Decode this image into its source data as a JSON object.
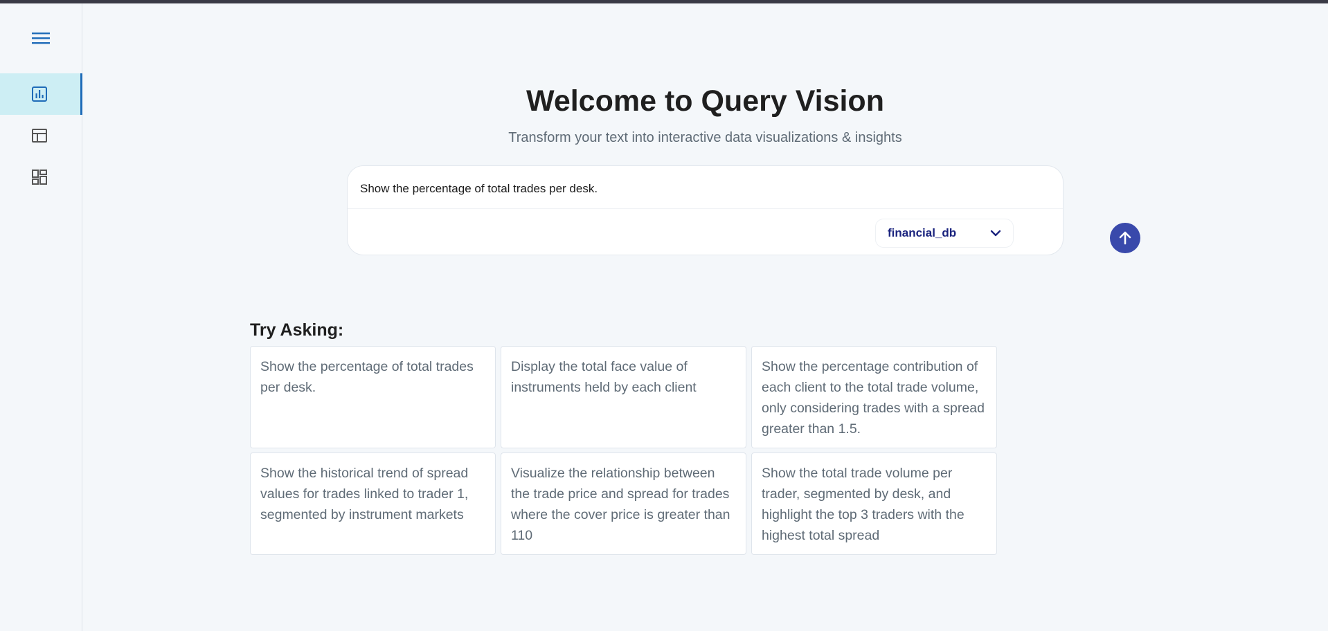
{
  "app": {
    "title": "Welcome to Query Vision",
    "subtitle": "Transform your text into interactive data visualizations & insights"
  },
  "sidebar": {
    "items": [
      {
        "icon": "bar-chart-icon",
        "active": true
      },
      {
        "icon": "table-icon",
        "active": false
      },
      {
        "icon": "dashboard-icon",
        "active": false
      }
    ]
  },
  "query": {
    "value": "Show the percentage of total trades per desk.",
    "database": "financial_db"
  },
  "suggestions": {
    "heading": "Try Asking:",
    "items": [
      "Show the percentage of total trades per desk.",
      "Display the total face value of instruments held by each client",
      "Show the percentage contribution of each client to the total trade volume, only considering trades with a spread greater than 1.5.",
      "Show the historical trend of spread values for trades linked to trader 1, segmented by instrument markets",
      "Visualize the relationship between the trade price and spread for trades where the cover price is greater than 110",
      "Show the total trade volume per trader, segmented by desk, and highlight the top 3 traders with the highest total spread"
    ]
  },
  "colors": {
    "accent": "#3949ab",
    "active_nav_bg": "#cdeef4",
    "active_nav_border": "#1e6bb8",
    "db_label": "#1a237e"
  }
}
